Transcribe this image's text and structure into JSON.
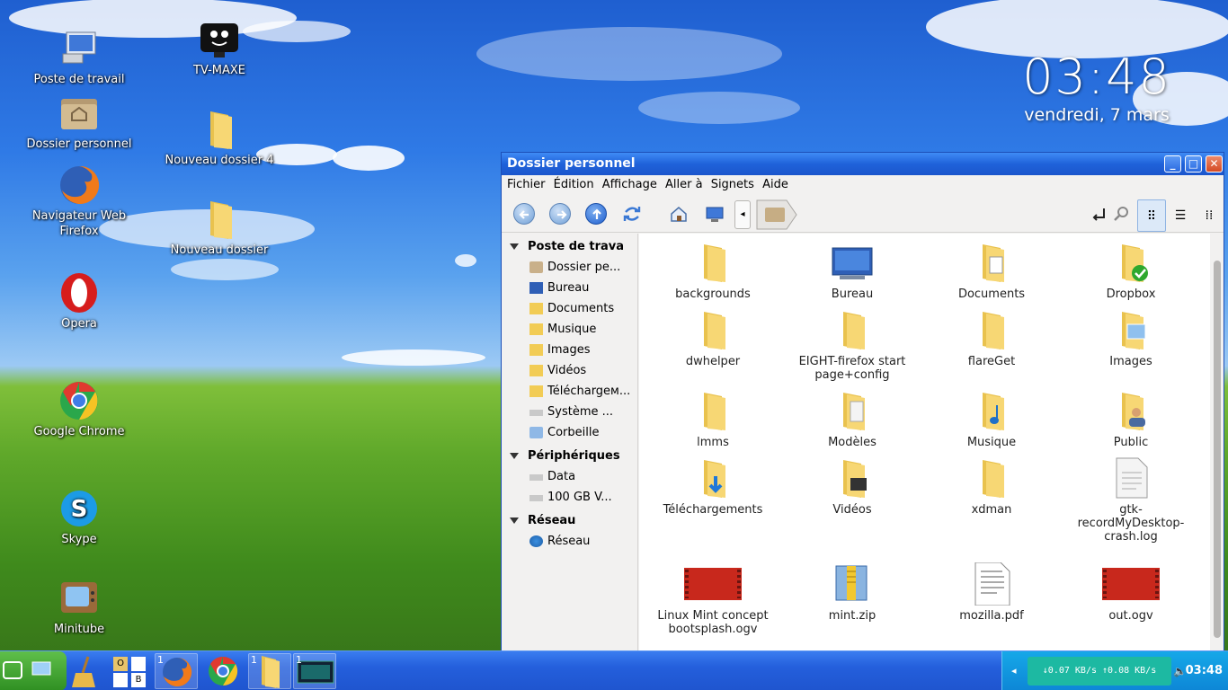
{
  "desktop": {
    "icons": [
      {
        "label": "Poste de travail",
        "icon": "computer-icon"
      },
      {
        "label": "TV-MAXE",
        "icon": "tv-maxe-icon"
      },
      {
        "label": "Dossier personnel",
        "icon": "home-folder-icon"
      },
      {
        "label": "Nouveau dossier 4",
        "icon": "folder-icon"
      },
      {
        "label": "Navigateur Web Firefox",
        "icon": "firefox-icon"
      },
      {
        "label": "Nouveau dossier",
        "icon": "folder-icon"
      },
      {
        "label": "Opera",
        "icon": "opera-icon"
      },
      {
        "label": "Google Chrome",
        "icon": "chrome-icon"
      },
      {
        "label": "Skype",
        "icon": "skype-icon"
      },
      {
        "label": "Minitube",
        "icon": "minitube-icon"
      }
    ]
  },
  "clock_widget": {
    "time": "03:48",
    "date": "vendredi, 7 mars"
  },
  "window": {
    "title": "Dossier personnel",
    "menu": [
      "Fichier",
      "Édition",
      "Affichage",
      "Aller à",
      "Signets",
      "Aide"
    ],
    "sidebar": {
      "sections": [
        {
          "title": "Poste de trava",
          "items": [
            {
              "label": "Dossier pe...",
              "icon": "home-folder-icon"
            },
            {
              "label": "Bureau",
              "icon": "desktop-icon"
            },
            {
              "label": "Documents",
              "icon": "documents-folder-icon"
            },
            {
              "label": "Musique",
              "icon": "music-folder-icon"
            },
            {
              "label": "Images",
              "icon": "pictures-folder-icon"
            },
            {
              "label": "Vidéos",
              "icon": "videos-folder-icon"
            },
            {
              "label": "Téléchargем...",
              "icon": "downloads-folder-icon"
            },
            {
              "label": "Système ...",
              "icon": "drive-icon"
            },
            {
              "label": "Corbeille",
              "icon": "trash-icon"
            }
          ]
        },
        {
          "title": "Périphériques",
          "items": [
            {
              "label": "Data",
              "icon": "drive-icon"
            },
            {
              "label": "100 GB V...",
              "icon": "drive-icon"
            }
          ]
        },
        {
          "title": "Réseau",
          "items": [
            {
              "label": "Réseau",
              "icon": "network-icon"
            }
          ]
        }
      ]
    },
    "files": [
      {
        "name": "backgrounds",
        "kind": "folder"
      },
      {
        "name": "Bureau",
        "kind": "desktop"
      },
      {
        "name": "Documents",
        "kind": "folder-doc"
      },
      {
        "name": "Dropbox",
        "kind": "folder-dropbox"
      },
      {
        "name": "dwhelper",
        "kind": "folder"
      },
      {
        "name": "EIGHT-firefox start page+config",
        "kind": "folder"
      },
      {
        "name": "flareGet",
        "kind": "folder"
      },
      {
        "name": "Images",
        "kind": "folder-images"
      },
      {
        "name": "lmms",
        "kind": "folder"
      },
      {
        "name": "Modèles",
        "kind": "folder-templates"
      },
      {
        "name": "Musique",
        "kind": "folder-music"
      },
      {
        "name": "Public",
        "kind": "folder-public"
      },
      {
        "name": "Téléchargements",
        "kind": "folder-download"
      },
      {
        "name": "Vidéos",
        "kind": "folder-video"
      },
      {
        "name": "xdman",
        "kind": "folder"
      },
      {
        "name": "gtk-recordMyDesktop-crash.log",
        "kind": "text"
      },
      {
        "name": "Linux Mint concept bootsplash.ogv",
        "kind": "video"
      },
      {
        "name": "mint.zip",
        "kind": "zip"
      },
      {
        "name": "mozilla.pdf",
        "kind": "pdf"
      },
      {
        "name": "out.ogv",
        "kind": "video"
      }
    ]
  },
  "taskbar": {
    "workspaces": [
      "O",
      "",
      "",
      "B"
    ],
    "task_count": "1",
    "netspeed": "↓0.07 KB/s ↑0.08 KB/s",
    "time": "03:48"
  },
  "colors": {
    "titlebar": "#1f62da",
    "taskbar": "#245fdc",
    "tray": "#0d86d6",
    "folder": "#f2cc55"
  }
}
